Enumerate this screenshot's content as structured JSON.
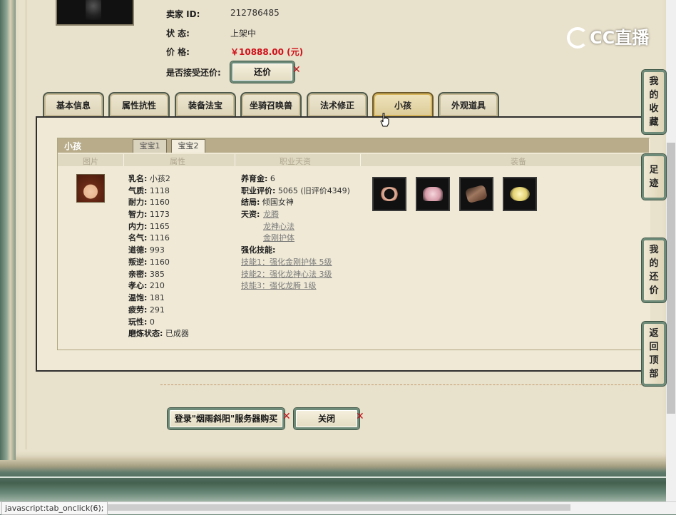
{
  "seller": {
    "id_label": "卖家 ID:",
    "id_value": "212786485",
    "status_label": "状 态:",
    "status_value": "上架中",
    "price_label": "价 格:",
    "price_value": "￥10888.00 (元)",
    "counter_label": "是否接受还价:",
    "counter_button": "还价"
  },
  "tabs": [
    "基本信息",
    "属性抗性",
    "装备法宝",
    "坐骑召唤兽",
    "法术修正",
    "小孩",
    "外观道具"
  ],
  "active_tab": "小孩",
  "child_panel": {
    "title": "小孩",
    "subtabs": [
      "宝宝1",
      "宝宝2"
    ],
    "active_subtab": "宝宝2",
    "columns": [
      "图片",
      "属性",
      "职业天资",
      "装备"
    ],
    "attributes": [
      {
        "k": "乳名:",
        "v": "小孩2"
      },
      {
        "k": "气质:",
        "v": "1118"
      },
      {
        "k": "耐力:",
        "v": "1160"
      },
      {
        "k": "智力:",
        "v": "1173"
      },
      {
        "k": "内力:",
        "v": "1165"
      },
      {
        "k": "名气:",
        "v": "1116"
      },
      {
        "k": "道德:",
        "v": "993"
      },
      {
        "k": "叛逆:",
        "v": "1160"
      },
      {
        "k": "亲密:",
        "v": "385"
      },
      {
        "k": "孝心:",
        "v": "210"
      },
      {
        "k": "温饱:",
        "v": "181"
      },
      {
        "k": "疲劳:",
        "v": "291"
      },
      {
        "k": "玩性:",
        "v": "0"
      },
      {
        "k": "磨炼状态:",
        "v": "已成器"
      }
    ],
    "career": {
      "nurture_label": "养育金:",
      "nurture_value": "6",
      "rating_label": "职业评价:",
      "rating_value": "5065 (旧评价4349)",
      "ending_label": "结局:",
      "ending_value": "倾国女神",
      "talent_label": "天资:",
      "talents": [
        "龙腾",
        "龙神心法",
        "金刚护体"
      ],
      "skills_label": "强化技能:",
      "skills": [
        "技能1：强化金刚护体 5级",
        "技能2：强化龙神心法 3级",
        "技能3：强化龙腾 1级"
      ]
    },
    "equipment_icons": [
      "wreath-icon",
      "pink-dress-icon",
      "instrument-icon",
      "ingot-icon"
    ]
  },
  "footer_buttons": {
    "login_buy": "登录\"烟雨斜阳\"服务器购买",
    "close": "关闭"
  },
  "side_nav": [
    {
      "name": "favorites",
      "chars": [
        "我",
        "的",
        "收",
        "藏"
      ]
    },
    {
      "name": "footprints",
      "chars": [
        "足",
        "迹"
      ]
    },
    {
      "name": "my-counteroffers",
      "chars": [
        "我",
        "的",
        "还",
        "价"
      ]
    },
    {
      "name": "back-to-top",
      "chars": [
        "返",
        "回",
        "顶",
        "部"
      ]
    }
  ],
  "watermark": "CC直播",
  "status_bar": "javascript:tab_onclick(6);"
}
